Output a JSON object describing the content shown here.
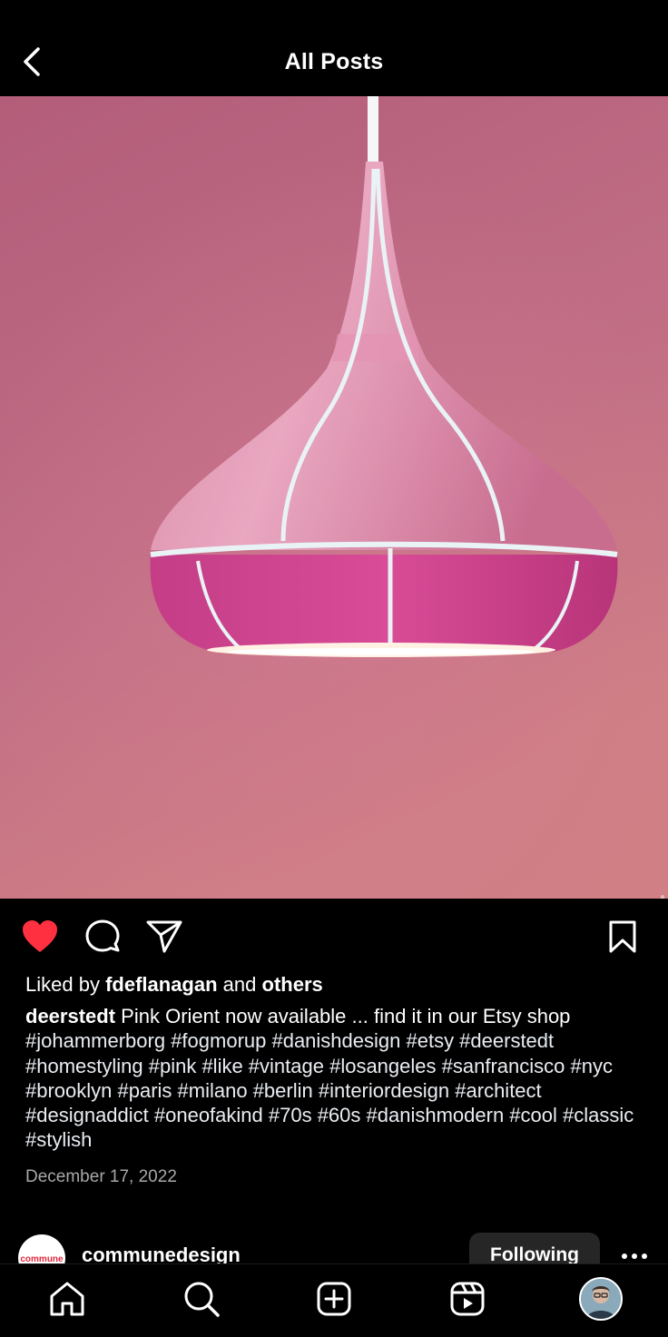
{
  "header": {
    "title": "All Posts",
    "back_icon": "chevron-left-icon"
  },
  "post": {
    "image_alt": "Pink pendant lamp on pink wall",
    "actions": {
      "like_icon": "heart-filled-icon",
      "comment_icon": "comment-icon",
      "share_icon": "send-icon",
      "save_icon": "bookmark-icon"
    },
    "likes": {
      "prefix": "Liked by",
      "user": "fdeflanagan",
      "middle": "and",
      "suffix": "others"
    },
    "caption": {
      "username": "deerstedt",
      "text": "Pink Orient now available ... find it in our Etsy shop",
      "hashtags": "#johammerborg #fogmorup #danishdesign #etsy #deerstedt #homestyling #pink #like #vintage #losangeles #sanfrancisco #nyc #brooklyn #paris #milano #berlin #interiordesign #architect #designaddict #oneofakind #70s #60s #danishmodern #cool #classic #stylish"
    },
    "date": "December 17, 2022"
  },
  "next_post": {
    "avatar_text": "commune",
    "username": "communedesign",
    "follow_label": "Following",
    "more_icon": "more-horizontal-icon"
  },
  "bottom_nav": {
    "items": [
      {
        "name": "home",
        "icon": "home-icon"
      },
      {
        "name": "search",
        "icon": "search-icon"
      },
      {
        "name": "create",
        "icon": "plus-square-icon"
      },
      {
        "name": "reels",
        "icon": "reels-icon"
      },
      {
        "name": "profile",
        "icon": "profile-avatar"
      }
    ]
  },
  "colors": {
    "background": "#000000",
    "like_red": "#ff3040",
    "follow_button_bg": "#262626",
    "date_gray": "#a8a8a8"
  }
}
